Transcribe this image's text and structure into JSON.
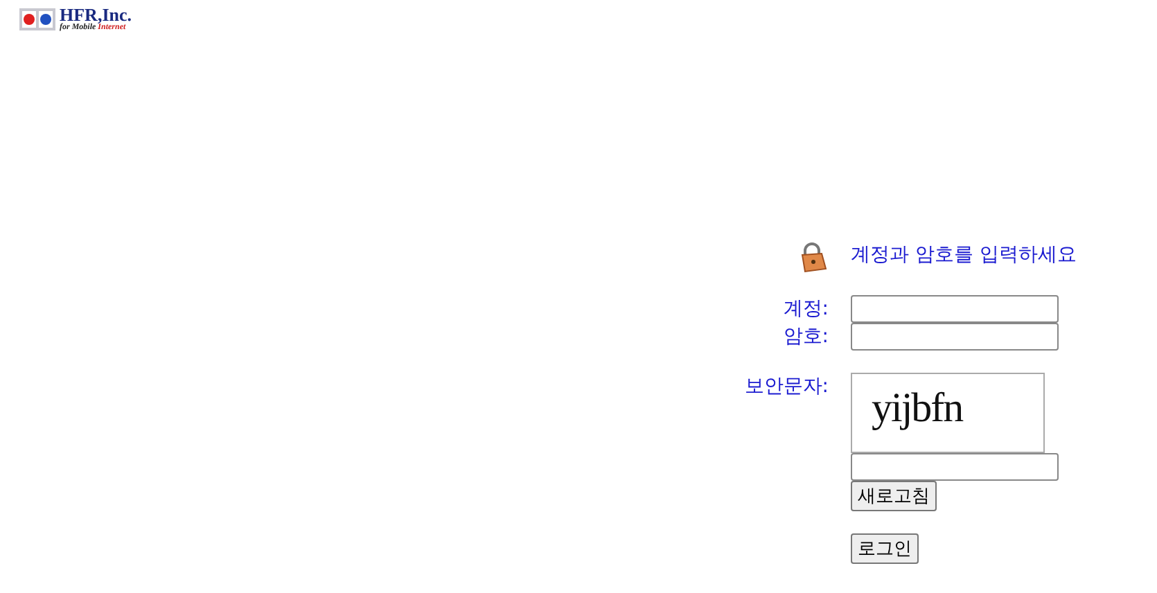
{
  "logo": {
    "name": "HFR,Inc.",
    "tagline_prefix": "for Mobile ",
    "tagline_suffix": "Internet"
  },
  "login": {
    "prompt": "계정과 암호를 입력하세요",
    "fields": [
      {
        "label": "계정:"
      },
      {
        "label": "암호:"
      }
    ],
    "captcha_label": "보안문자:",
    "captcha_text": "yijbfn",
    "refresh_button": "새로고침",
    "login_button": "로그인"
  }
}
